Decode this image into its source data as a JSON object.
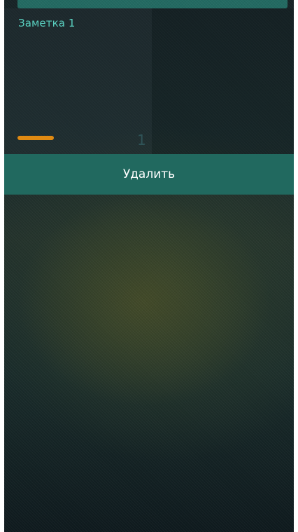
{
  "note": {
    "title": "Заметка 1",
    "count": "1"
  },
  "actions": {
    "delete_label": "Удалить"
  },
  "colors": {
    "accent": "#21695f",
    "title_text": "#59cfbf",
    "priority": "#e08a12",
    "background_dark": "#0f1a1e"
  }
}
